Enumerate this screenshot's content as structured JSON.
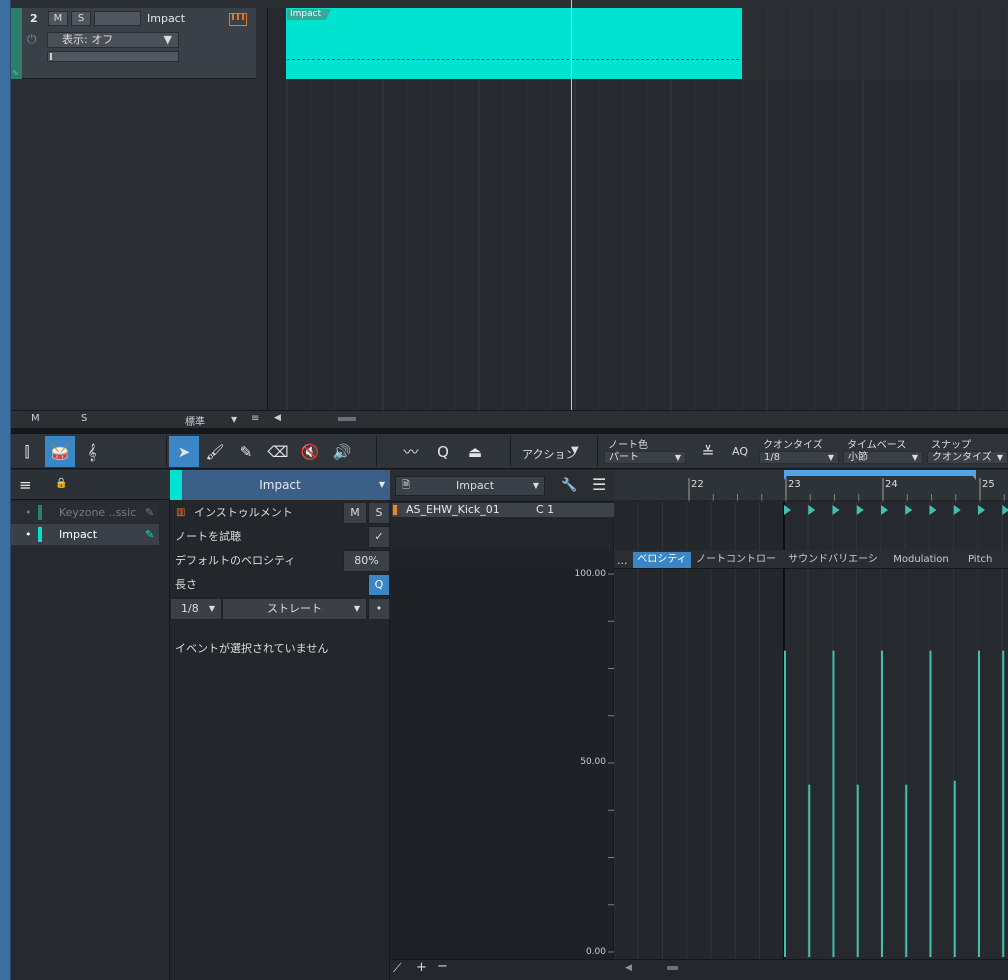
{
  "arrange": {
    "track_number": "2",
    "mute_label": "M",
    "solo_label": "S",
    "track_name": "Impact",
    "display_dropdown": "表示: オフ",
    "region_label": "Impact",
    "footer_m": "M",
    "footer_s": "S",
    "footer_zoom": "標準"
  },
  "toolbar": {
    "action_label": "アクション",
    "note_color_label": "ノート色",
    "note_color_value": "パート",
    "aq_label": "AQ",
    "quantize_label": "クオンタイズ",
    "quantize_value": "1/8",
    "timebase_label": "タイムベース",
    "timebase_value": "小節",
    "snap_label": "スナップ",
    "snap_value": "クオンタイズ"
  },
  "list": {
    "items": [
      {
        "label": "Keyzone ..ssic"
      },
      {
        "label": "Impact"
      }
    ]
  },
  "inspector": {
    "title": "Impact",
    "instrument_label": "インストゥルメント",
    "m_label": "M",
    "s_label": "S",
    "preview_label": "ノートを試聴",
    "preview_check": "✓",
    "velocity_label": "デフォルトのベロシティ",
    "velocity_value": "80%",
    "length_label": "長さ",
    "length_q": "Q",
    "length_value": "1/8",
    "length_mode": "ストレート",
    "length_dot": "•",
    "no_event": "イベントが選択されていません"
  },
  "pianoroll": {
    "instrument_dd": "Impact",
    "ruler": [
      "22",
      "23",
      "24",
      "25"
    ],
    "note_name": "AS_EHW_Kick_01",
    "note_pitch": "C 1",
    "tabs_more": "...",
    "tabs": [
      "ベロシティ",
      "ノートコントローラー",
      "サウンドバリエーション",
      "Modulation",
      "Pitch Be"
    ],
    "vel_labels": [
      "100.00",
      "50.00",
      "0.00"
    ],
    "velocities": [
      80,
      45,
      80,
      45,
      80,
      45,
      80,
      46,
      80,
      80
    ]
  }
}
